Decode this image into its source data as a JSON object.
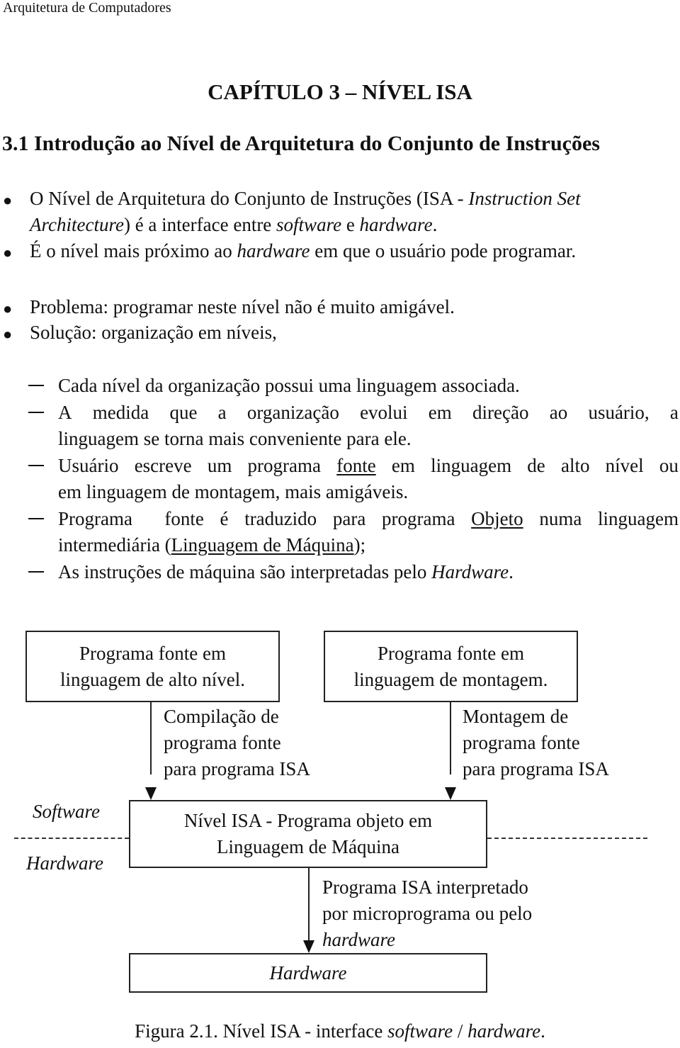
{
  "header": "Arquitetura de Computadores",
  "chapter_title": "CAPÍTULO 3 – NÍVEL ISA",
  "section_title": "3.1 Introdução ao Nível de Arquitetura do Conjunto de Instruções",
  "bullets": {
    "b1_line1_a": "O Nível de Arquitetura do Conjunto de Instruções (ISA - ",
    "b1_line1_italic": "Instruction Set",
    "b1_line2_italic": "Architecture",
    "b1_line2_a": ") é a interface entre ",
    "b1_line2_italic2": "software",
    "b1_line2_b": " e ",
    "b1_line2_italic3": "hardware",
    "b1_line2_c": ".",
    "b2_a": "É o nível mais próximo ao ",
    "b2_italic": "hardware",
    "b2_b": " em que o usuário pode programar.",
    "b3": "Problema: programar neste nível não é muito amigável.",
    "b4": "Solução: organização em níveis,"
  },
  "dashes": {
    "d1": "Cada nível da organização possui uma linguagem associada.",
    "d2_words": [
      "A",
      "medida",
      "que",
      "a",
      "organização",
      "evolui",
      "em",
      "direção",
      "ao",
      "usuário,",
      "a"
    ],
    "d2_line2": "linguagem se torna mais conveniente para ele.",
    "d3_line1_words": [
      "Usuário",
      "escreve",
      "um",
      "programa",
      "fonte",
      "em",
      "linguagem",
      "de",
      "alto",
      "nível",
      "ou"
    ],
    "d3_line2": "em linguagem de montagem, mais amigáveis.",
    "d4_line1_a": "Programa  fonte é traduzido para programa ",
    "d4_line1_underline": "Objeto",
    "d4_line1_b": " numa linguagem",
    "d4_line2_a": "intermediária (",
    "d4_line2_underline": "Linguagem de Máquina",
    "d4_line2_b": ");",
    "d5_a": "As instruções de máquina são interpretadas pelo ",
    "d5_italic": "Hardware",
    "d5_b": "."
  },
  "figure": {
    "box_high_level": [
      "Programa fonte em",
      "linguagem de alto nível."
    ],
    "box_assembly": [
      "Programa fonte em",
      "linguagem de montagem."
    ],
    "label_compile": [
      "Compilação de",
      "programa fonte",
      "para programa ISA"
    ],
    "label_assemble": [
      "Montagem de",
      "programa fonte",
      "para programa ISA"
    ],
    "side_software": "Software",
    "side_hardware": "Hardware",
    "box_isa": [
      "Nível ISA - Programa objeto em",
      "Linguagem de Máquina"
    ],
    "label_interpret": [
      "Programa ISA interpretado",
      "por microprograma ou pelo"
    ],
    "label_interpret_italic": "hardware",
    "box_hardware": "Hardware",
    "caption_a": "Figura 2.1. Nível ISA - interface ",
    "caption_italic1": "software",
    "caption_b": " / ",
    "caption_italic2": "hardware",
    "caption_c": "."
  }
}
